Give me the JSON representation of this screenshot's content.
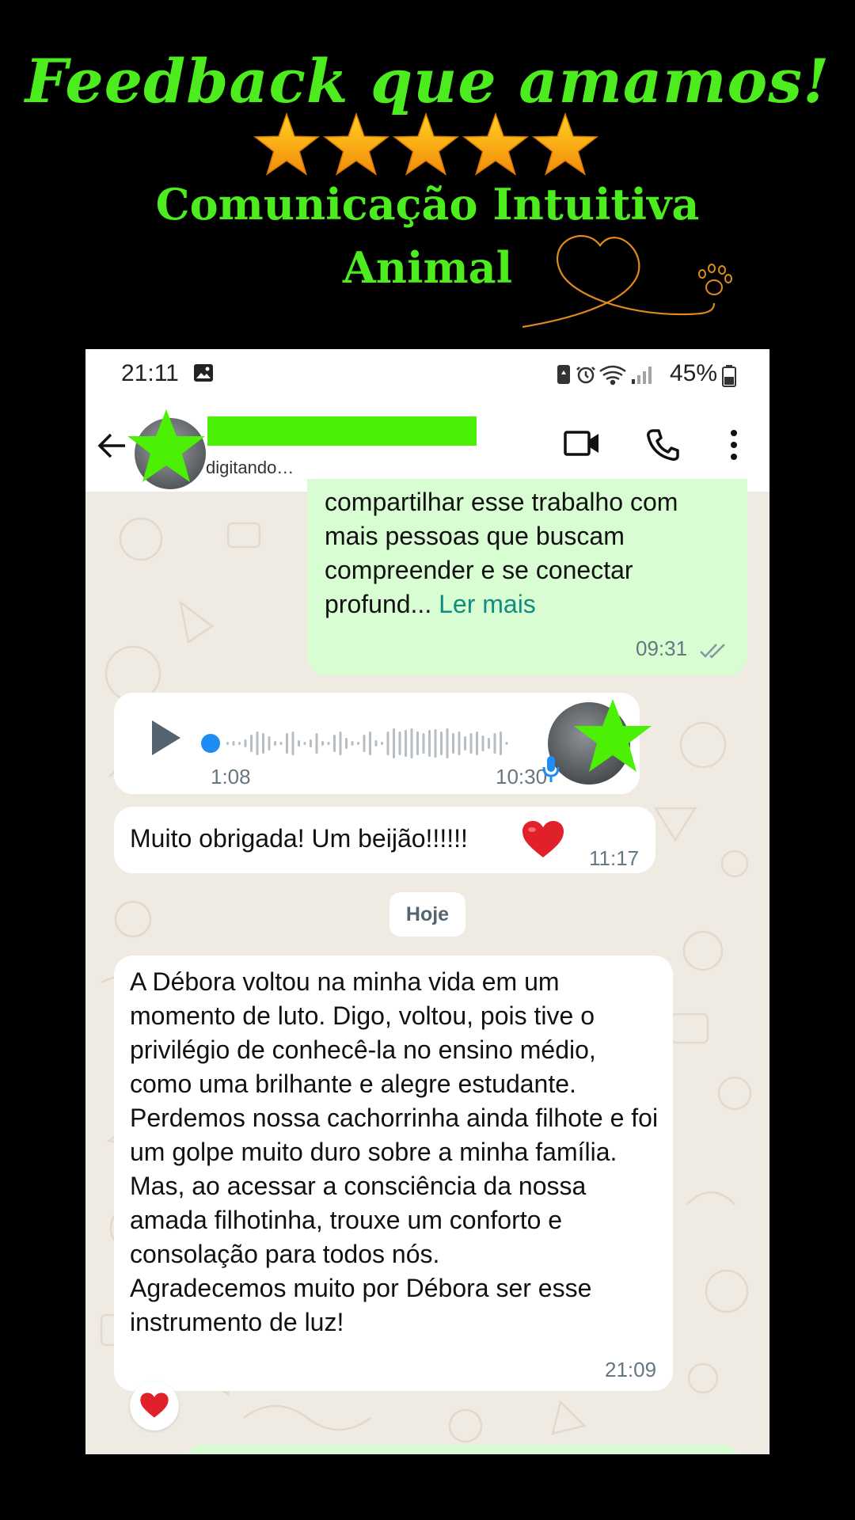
{
  "banner": {
    "headline": "Feedback que amamos!",
    "rating_stars": 5,
    "subtitle_line1": "Comunicação Intuitiva",
    "subtitle_line2": "Animal",
    "star_color": "#f7a11a",
    "text_color": "#4cec1e",
    "decoration_icons": [
      "heart-outline-icon",
      "paw-icon"
    ]
  },
  "status_bar": {
    "time": "21:11",
    "battery": "45%",
    "icons": [
      "gallery-icon",
      "battery-saver-icon",
      "alarm-icon",
      "wifi-icon",
      "signal-icon",
      "battery-icon"
    ]
  },
  "app_bar": {
    "contact_status": "digitando…",
    "icons": [
      "back-arrow-icon",
      "video-call-icon",
      "phone-icon",
      "more-options-icon"
    ]
  },
  "messages": {
    "outgoing": {
      "text": "compartilhar esse trabalho com mais pessoas que buscam compreender e se conectar profund... ",
      "read_more": "Ler mais",
      "time": "09:31"
    },
    "audio": {
      "duration": "1:08",
      "time": "10:30"
    },
    "thanks": {
      "text": "Muito obrigada! Um beijão!!!!!!",
      "time": "11:17"
    },
    "date_divider": "Hoje",
    "long": {
      "text": "A Débora voltou na minha vida em um momento de luto. Digo, voltou, pois tive o privilégio de conhecê-la no ensino médio, como uma brilhante e alegre estudante.\nPerdemos nossa cachorrinha ainda filhote e foi um golpe muito duro sobre a minha família.\nMas, ao acessar a consciência da nossa amada filhotinha, trouxe um conforto e consolação para todos nós.\nAgradecemos muito por Débora ser esse instrumento de luz!",
      "time": "21:09",
      "reaction": "heart"
    }
  },
  "colors": {
    "outgoing_bubble": "#d9fdd3",
    "incoming_bubble": "#ffffff",
    "chat_background": "#efeae2",
    "link": "#128c7e",
    "redaction": "#4cf005"
  }
}
